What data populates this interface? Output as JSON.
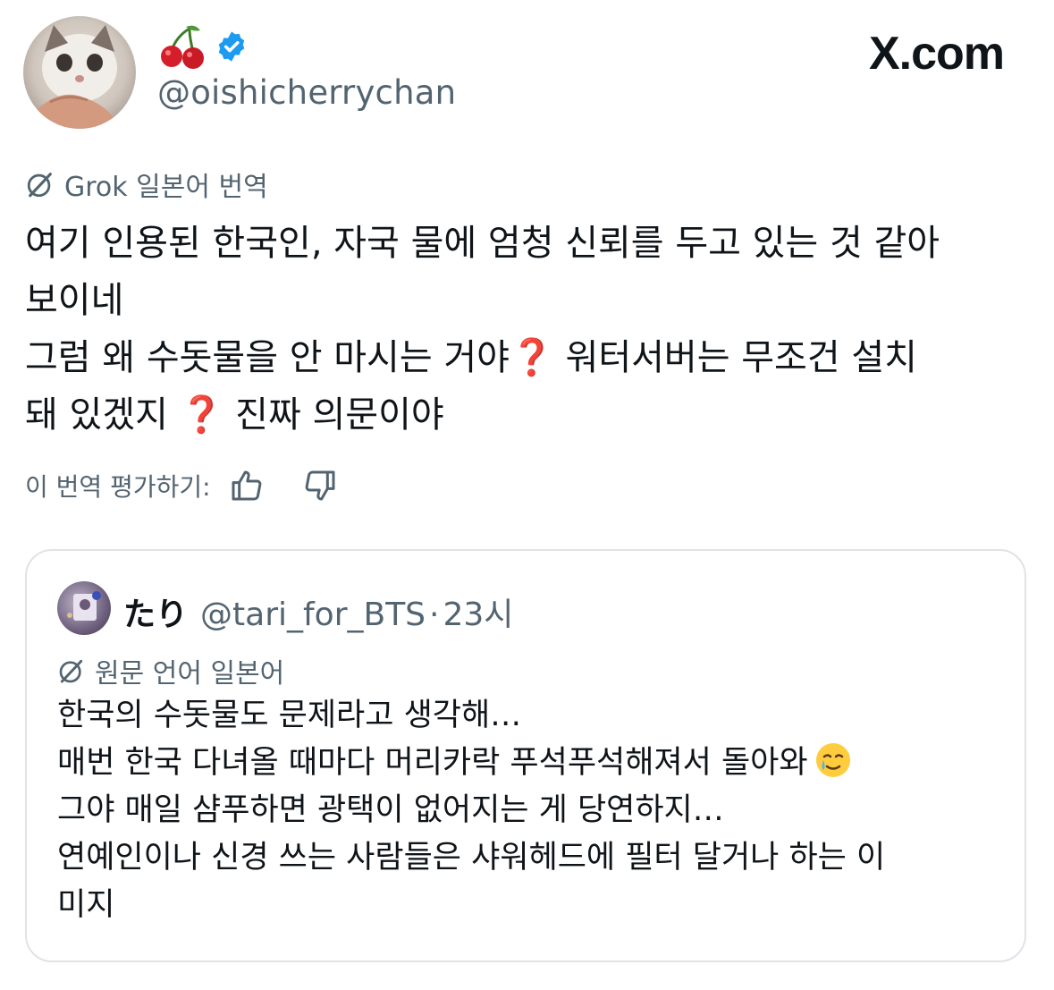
{
  "brand": "X.com",
  "author": {
    "display_name_icon": "cherry-emoji-icon",
    "verified_icon": "verified-badge-icon",
    "handle": "@oishicherrychan"
  },
  "translation_banner": {
    "icon": "grok-icon",
    "label": "Grok 일본어 번역"
  },
  "tweet": {
    "lines": [
      "여기 인용된 한국인, 자국 물에 엄청 신뢰를 두고 있는 것 같아",
      "보이네",
      "그럼 왜 수돗물을 안 마시는 거야",
      "워터서버는 무조건 설치",
      "돼 있겠지",
      "진짜 의문이야"
    ],
    "question_mark": "❓"
  },
  "rating": {
    "label": "이 번역 평가하기:",
    "like_icon": "thumbs-up-icon",
    "dislike_icon": "thumbs-down-icon"
  },
  "quote": {
    "display_name": "たり",
    "handle": "@tari_for_BTS",
    "separator": "·",
    "time": "23시",
    "language_label": "원문 언어 일본어",
    "lines": [
      "한국의 수돗물도 문제라고 생각해…",
      "매번 한국 다녀올 때마다 머리카락 푸석푸석해져서 돌아와",
      "그야 매일 샴푸하면 광택이 없어지는 게 당연하지…",
      "연예인이나 신경 쓰는 사람들은 샤워헤드에 필터 달거나 하는 이",
      "미지"
    ],
    "emoji_icon": "crying-smile-emoji-icon"
  }
}
